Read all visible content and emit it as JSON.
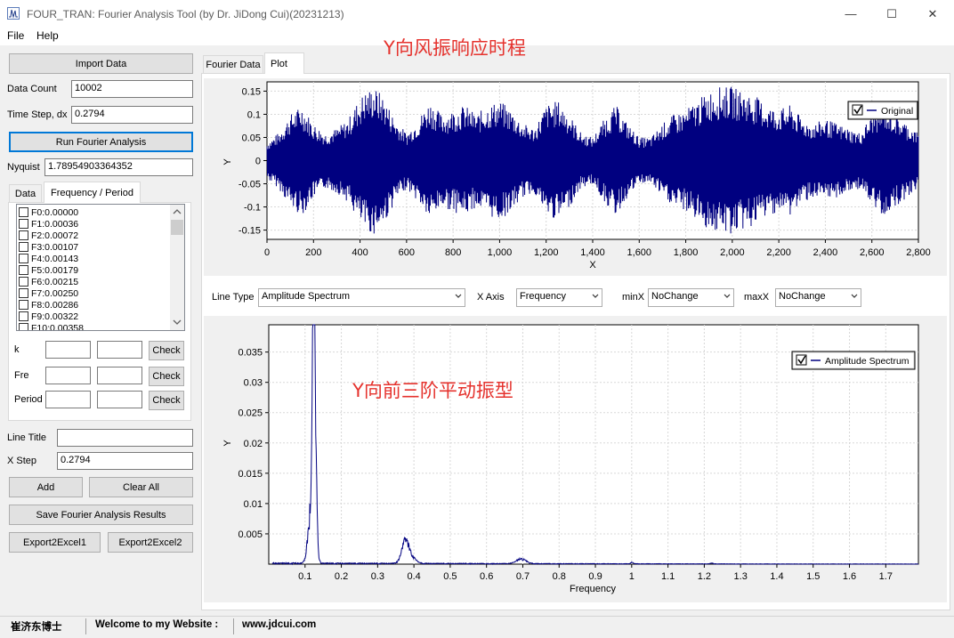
{
  "window": {
    "title": "FOUR_TRAN: Fourier Analysis Tool (by Dr. JiDong Cui)(20231213)",
    "minimize_glyph": "—",
    "maximize_glyph": "☐",
    "close_glyph": "✕"
  },
  "menu": {
    "file": "File",
    "help": "Help"
  },
  "left": {
    "import_button": "Import Data",
    "data_count_label": "Data Count",
    "data_count_value": "10002",
    "time_step_label": "Time Step, dx",
    "time_step_value": "0.2794",
    "run_button": "Run Fourier Analysis",
    "nyquist_label": "Nyquist",
    "nyquist_value": "1.78954903364352",
    "tabs": [
      "Data",
      "Frequency / Period"
    ],
    "freq_list": [
      "F0:0.00000",
      "F1:0.00036",
      "F2:0.00072",
      "F3:0.00107",
      "F4:0.00143",
      "F5:0.00179",
      "F6:0.00215",
      "F7:0.00250",
      "F8:0.00286",
      "F9:0.00322",
      "F10:0.00358"
    ],
    "k_label": "k",
    "fre_label": "Fre",
    "period_label": "Period",
    "check_label": "Check",
    "line_title_label": "Line Title",
    "line_title_value": "",
    "x_step_label": "X Step",
    "x_step_value": "0.2794",
    "add_button": "Add",
    "clear_button": "Clear All",
    "save_button": "Save Fourier Analysis Results",
    "export1_button": "Export2Excel1",
    "export2_button": "Export2Excel2"
  },
  "right": {
    "tabs": [
      "Fourier Data",
      "Plot"
    ],
    "line_type_label": "Line Type",
    "line_type_value": "Amplitude Spectrum",
    "x_axis_label": "X Axis",
    "x_axis_value": "Frequency",
    "minx_label": "minX",
    "minx_value": "NoChange",
    "maxx_label": "maxX",
    "maxx_value": "NoChange"
  },
  "annotations": {
    "top": "Y向风振响应时程",
    "middle": "Y向前三阶平动振型"
  },
  "status": {
    "name": "崔济东博士",
    "welcome": "Welcome to my Website :",
    "url": "www.jdcui.com"
  },
  "colors": {
    "series": "#000080",
    "annotation": "#e5322d",
    "focus": "#0078d7"
  },
  "chart_data": [
    {
      "type": "line",
      "title": "",
      "xlabel": "X",
      "ylabel": "Y",
      "xlim": [
        0,
        2800
      ],
      "ylim": [
        -0.17,
        0.17
      ],
      "xticks": [
        "0",
        "200",
        "400",
        "600",
        "800",
        "1,000",
        "1,200",
        "1,400",
        "1,600",
        "1,800",
        "2,000",
        "2,200",
        "2,400",
        "2,600",
        "2,800"
      ],
      "yticks": [
        "0.15",
        "0.1",
        "0.05",
        "0",
        "-0.05",
        "-0.1",
        "-0.15"
      ],
      "ytick_values": [
        0.15,
        0.1,
        0.05,
        0,
        -0.05,
        -0.1,
        -0.15
      ],
      "grid": true,
      "legend_position": "top-right",
      "series": [
        {
          "name": "Original",
          "description_envelope": true,
          "x": [
            0,
            50,
            100,
            150,
            200,
            250,
            300,
            350,
            380,
            420,
            460,
            500,
            550,
            600,
            650,
            700,
            750,
            800,
            850,
            900,
            950,
            1000,
            1050,
            1100,
            1150,
            1200,
            1250,
            1300,
            1350,
            1400,
            1450,
            1500,
            1550,
            1600,
            1650,
            1700,
            1750,
            1800,
            1850,
            1900,
            1950,
            2000,
            2050,
            2100,
            2150,
            2200,
            2250,
            2300,
            2350,
            2400,
            2450,
            2500,
            2550,
            2600,
            2650,
            2700,
            2750,
            2800
          ],
          "amplitude": [
            0.04,
            0.06,
            0.1,
            0.12,
            0.08,
            0.06,
            0.07,
            0.09,
            0.12,
            0.15,
            0.16,
            0.14,
            0.09,
            0.06,
            0.09,
            0.13,
            0.1,
            0.11,
            0.12,
            0.1,
            0.12,
            0.13,
            0.11,
            0.08,
            0.07,
            0.12,
            0.13,
            0.1,
            0.06,
            0.05,
            0.09,
            0.12,
            0.08,
            0.05,
            0.05,
            0.08,
            0.1,
            0.11,
            0.13,
            0.15,
            0.16,
            0.16,
            0.15,
            0.14,
            0.12,
            0.11,
            0.12,
            0.09,
            0.08,
            0.09,
            0.08,
            0.07,
            0.06,
            0.1,
            0.12,
            0.1,
            0.08,
            0.06
          ]
        }
      ]
    },
    {
      "type": "line",
      "title": "",
      "xlabel": "Frequency",
      "ylabel": "Y",
      "xlim": [
        0,
        1.79
      ],
      "ylim": [
        0,
        0.0395
      ],
      "xticks": [
        "0.1",
        "0.2",
        "0.3",
        "0.4",
        "0.5",
        "0.6",
        "0.7",
        "0.8",
        "0.9",
        "1",
        "1.1",
        "1.2",
        "1.3",
        "1.4",
        "1.5",
        "1.6",
        "1.7"
      ],
      "yticks": [
        "0.035",
        "0.03",
        "0.025",
        "0.02",
        "0.015",
        "0.01",
        "0.005"
      ],
      "ytick_values": [
        0.035,
        0.03,
        0.025,
        0.02,
        0.015,
        0.01,
        0.005
      ],
      "grid": true,
      "legend_position": "top-right",
      "series": [
        {
          "name": "Amplitude Spectrum",
          "peaks": [
            {
              "f": 0.123,
              "a": 0.0395,
              "w": 0.004
            },
            {
              "f": 0.127,
              "a": 0.028,
              "w": 0.006
            },
            {
              "f": 0.118,
              "a": 0.012,
              "w": 0.012
            },
            {
              "f": 0.375,
              "a": 0.0035,
              "w": 0.012
            },
            {
              "f": 0.385,
              "a": 0.002,
              "w": 0.02
            },
            {
              "f": 0.695,
              "a": 0.0009,
              "w": 0.02
            },
            {
              "f": 1.0,
              "a": 0.0003,
              "w": 0.005
            },
            {
              "f": 1.22,
              "a": 0.0002,
              "w": 0.005
            }
          ],
          "noise_floor": 0.0003
        }
      ]
    }
  ]
}
